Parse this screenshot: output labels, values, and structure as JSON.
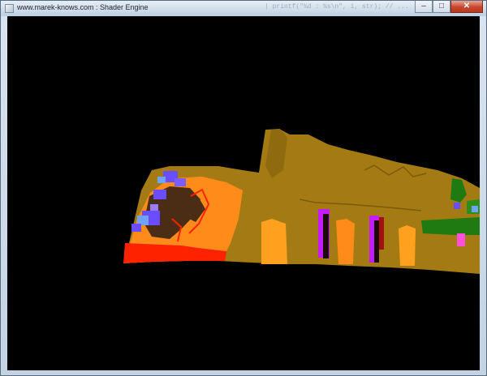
{
  "window": {
    "title": "www.marek-knows.com : Shader Engine",
    "controls": {
      "minimize_glyph": "–",
      "maximize_glyph": "□",
      "close_glyph": "✕"
    }
  },
  "viewport": {
    "background": "#000000",
    "colors": {
      "terrain": "#a47a12",
      "orange": "#ff8c1a",
      "bright_orange": "#ffa11f",
      "red": "#ff2200",
      "dark_brown": "#4a2d14",
      "blue": "#6a4dff",
      "light_blue": "#6fa3ff",
      "magenta": "#c41cff",
      "green": "#1f7a12",
      "pink": "#ff4fd8"
    }
  }
}
